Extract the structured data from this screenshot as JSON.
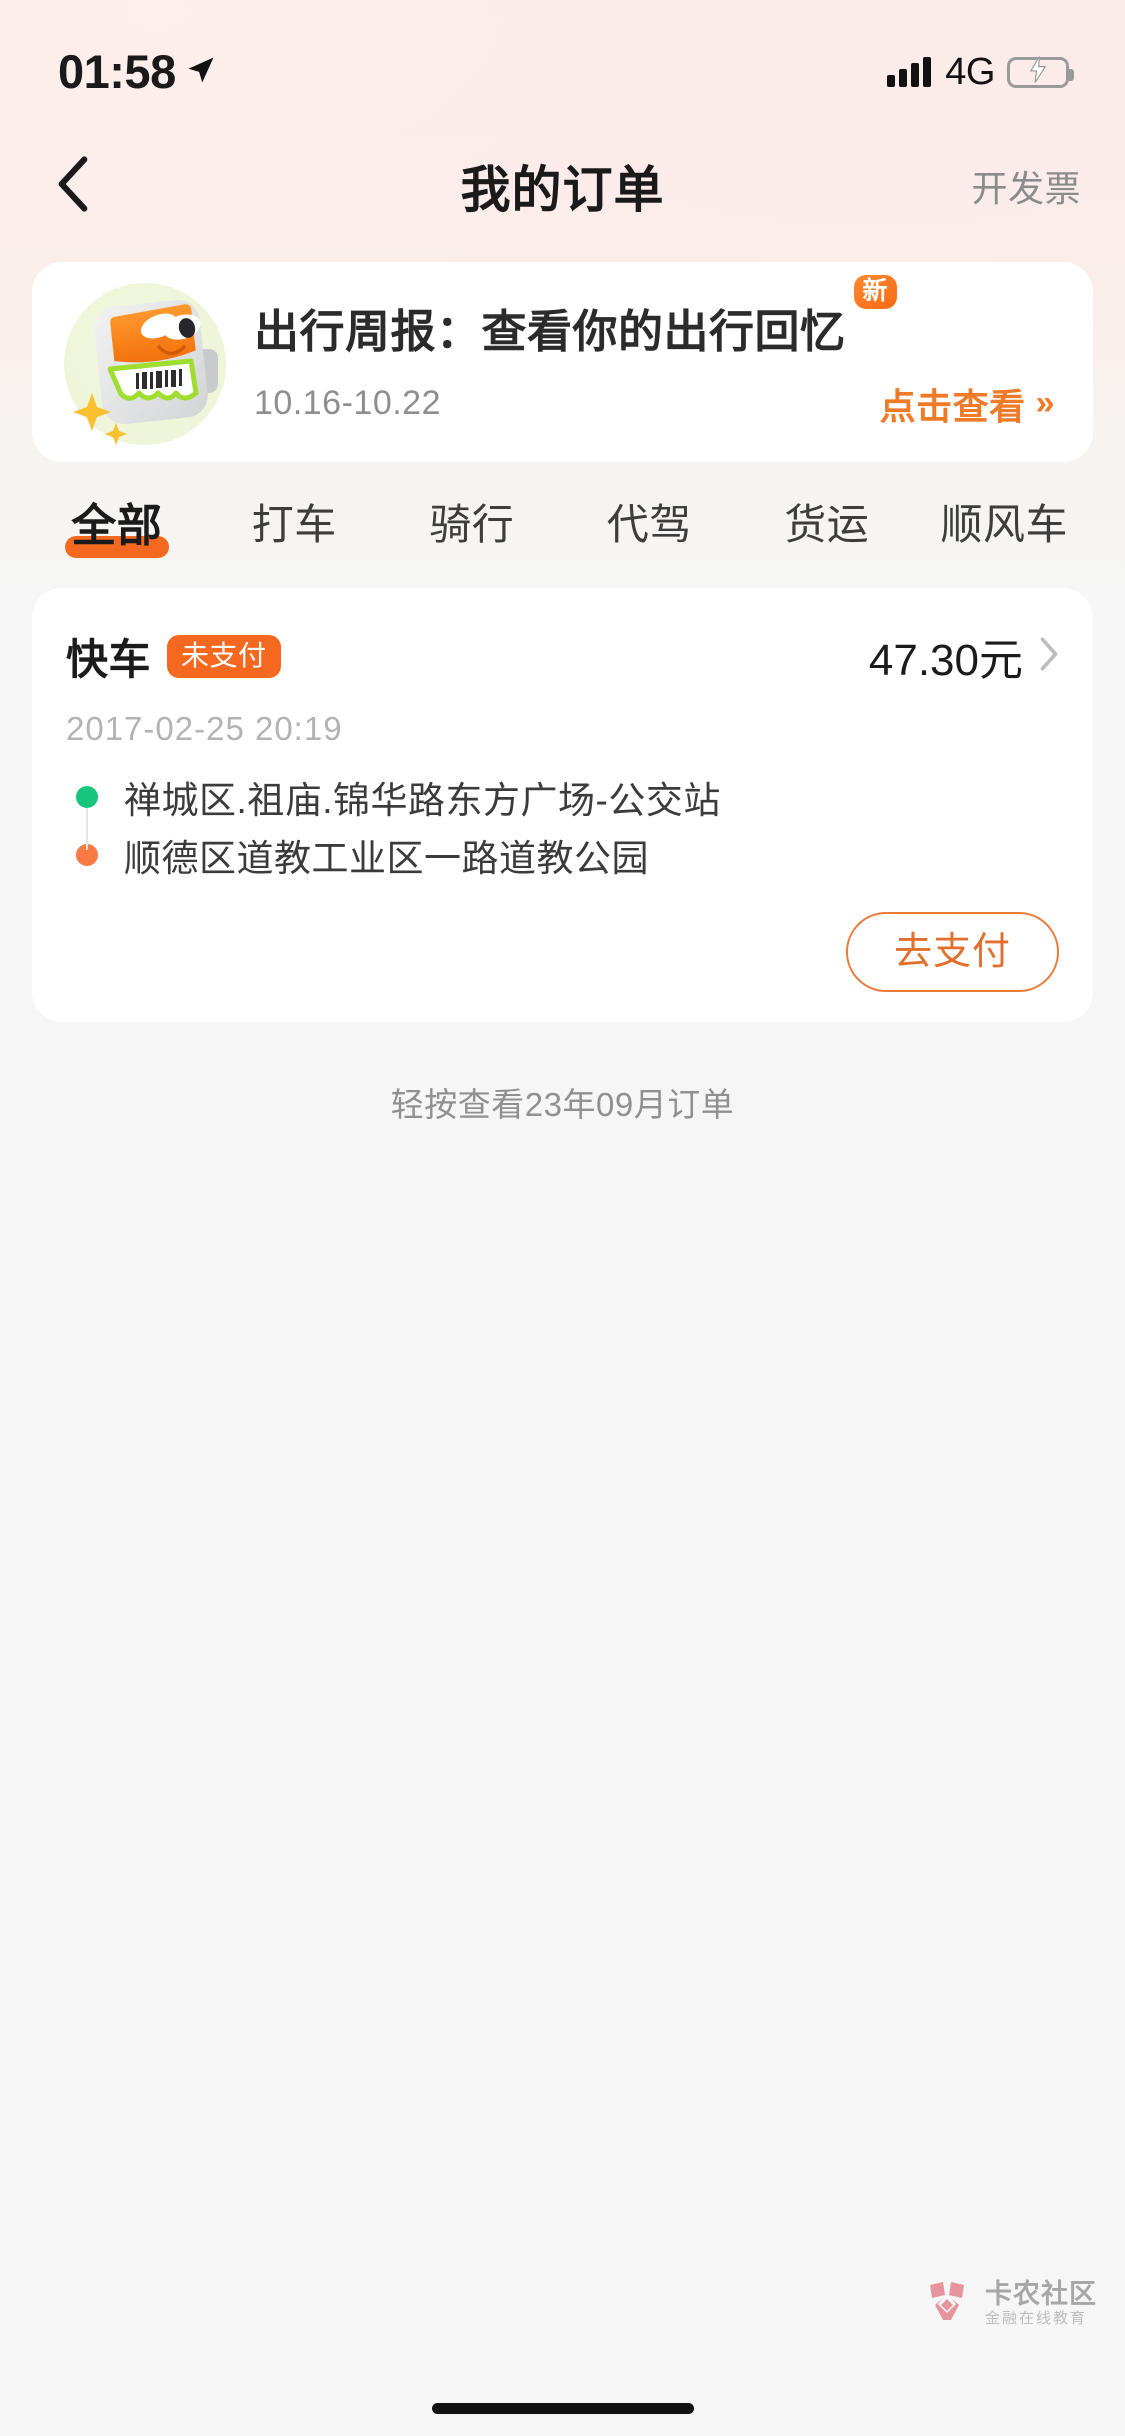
{
  "status_bar": {
    "time": "01:58",
    "location_icon": "location-arrow-icon",
    "signal_icon": "signal-bars-icon",
    "network": "4G",
    "battery_icon": "battery-charging-icon",
    "battery_color": "#32d74b"
  },
  "nav": {
    "back_icon": "chevron-left-icon",
    "title": "我的订单",
    "action_label": "开发票"
  },
  "banner": {
    "mascot_icon": "robot-mascot-icon",
    "title": "出行周报：查看你的出行回忆",
    "badge": "新",
    "date_range": "10.16-10.22",
    "cta_label": "点击查看",
    "cta_icon": "double-chevron-right-icon"
  },
  "tabs": [
    {
      "label": "全部",
      "active": true
    },
    {
      "label": "打车",
      "active": false
    },
    {
      "label": "骑行",
      "active": false
    },
    {
      "label": "代驾",
      "active": false
    },
    {
      "label": "货运",
      "active": false
    },
    {
      "label": "顺风车",
      "active": false
    }
  ],
  "order": {
    "service": "快车",
    "status": "未支付",
    "price": "47.30元",
    "chevron_icon": "chevron-right-icon",
    "datetime": "2017-02-25 20:19",
    "origin": "禅城区.祖庙.锦华路东方广场-公交站",
    "destination": "顺德区道教工业区一路道教公园",
    "pay_button": "去支付"
  },
  "footer": {
    "hint": "轻按查看23年09月订单"
  },
  "watermark": {
    "logo_icon": "kanong-flower-logo-icon",
    "name": "卡农社区",
    "sub": "金融在线教育"
  },
  "colors": {
    "accent_orange": "#f4691f",
    "cta_orange": "#ef7a28",
    "origin_dot": "#19c47d",
    "dest_dot": "#f97a42",
    "battery_green": "#32d74b"
  }
}
